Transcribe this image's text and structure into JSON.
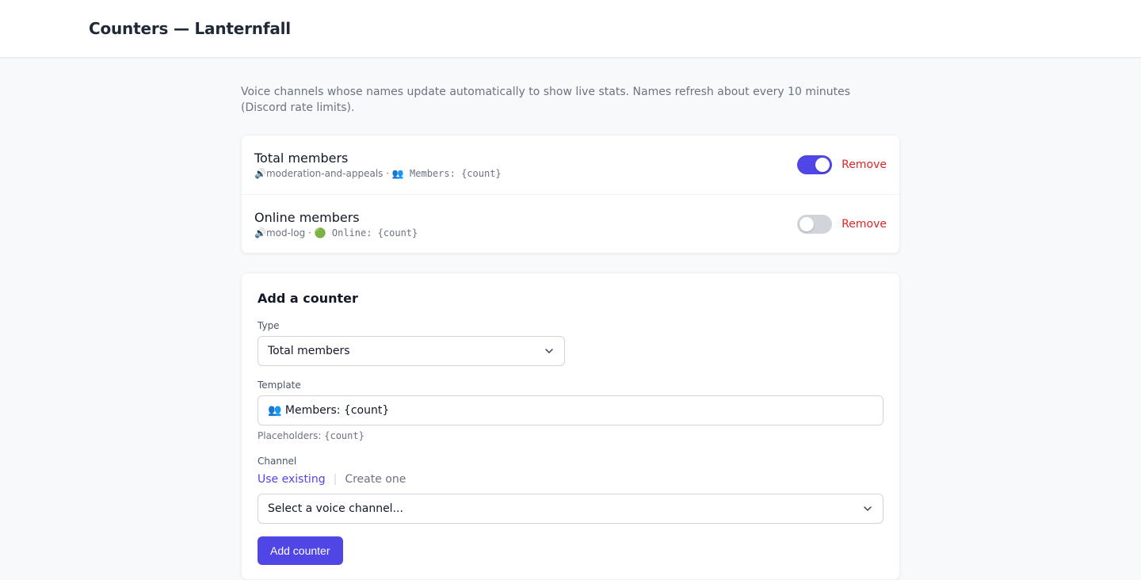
{
  "header": {
    "title": "Counters — Lanternfall"
  },
  "intro": "Voice channels whose names update automatically to show live stats. Names refresh about every 10 minutes (Discord rate limits).",
  "counters": [
    {
      "name": "Total members",
      "channel_icon": "🔊",
      "channel": "moderation-and-appeals",
      "separator": "·",
      "template": "👥 Members: {count}",
      "enabled": true,
      "remove_label": "Remove"
    },
    {
      "name": "Online members",
      "channel_icon": "🔊",
      "channel": "mod-log",
      "separator": "·",
      "template": "🟢 Online: {count}",
      "enabled": false,
      "remove_label": "Remove"
    }
  ],
  "add_form": {
    "title": "Add a counter",
    "type_label": "Type",
    "type_value": "Total members",
    "template_label": "Template",
    "template_value": "👥 Members: {count}",
    "placeholders_prefix": "Placeholders:",
    "placeholders_value": "{count}",
    "channel_label": "Channel",
    "mode_existing": "Use existing",
    "mode_separator": "|",
    "mode_create": "Create one",
    "channel_select_placeholder": "Select a voice channel...",
    "submit_label": "Add counter"
  },
  "colors": {
    "accent": "#4f46e5",
    "danger": "#dc2626",
    "toggle_off": "#d1d5db"
  },
  "icons": {
    "toggle": "toggle-switch",
    "chevron": "chevron-down-icon",
    "speaker": "speaker-icon"
  }
}
